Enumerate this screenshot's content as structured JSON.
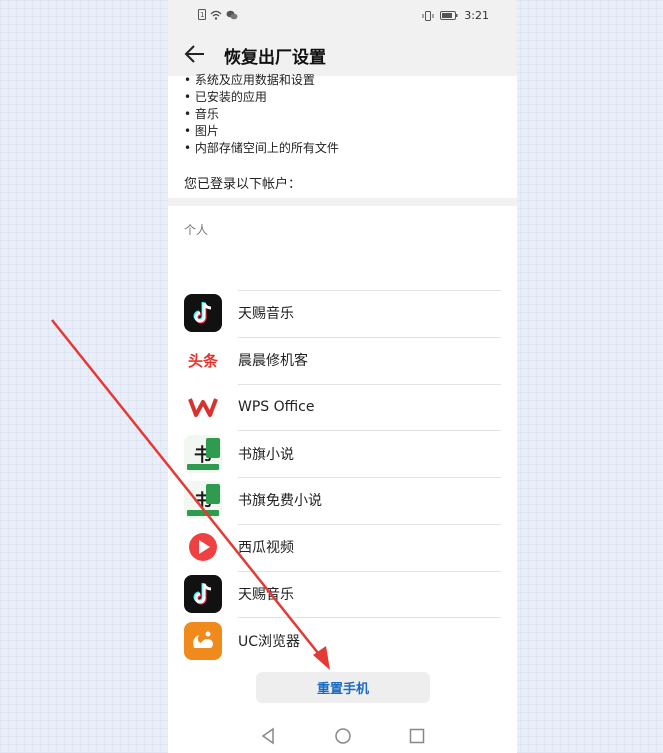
{
  "status_bar": {
    "time": "3:21"
  },
  "header": {
    "title": "恢复出厂设置"
  },
  "erase_list": [
    "系统及应用数据和设置",
    "已安装的应用",
    "音乐",
    "图片",
    "内部存储空间上的所有文件"
  ],
  "accounts": {
    "title": "您已登录以下帐户：",
    "group_label": "个人",
    "items": [
      {
        "name": "天赐音乐",
        "icon": "tiktok-icon",
        "icon_color": "#111111"
      },
      {
        "name": "晨晨修机客",
        "icon": "toutiao-icon",
        "icon_color": "#e8322b",
        "icon_text": "头条"
      },
      {
        "name": "WPS Office",
        "icon": "wps-icon",
        "icon_color": "#d9312b"
      },
      {
        "name": "书旗小说",
        "icon": "shuqi-icon",
        "icon_color": "#2e9b4f",
        "icon_text": "书"
      },
      {
        "name": "书旗免费小说",
        "icon": "shuqi-free-icon",
        "icon_color": "#2e9b4f",
        "icon_text": "书"
      },
      {
        "name": "西瓜视频",
        "icon": "xigua-icon",
        "icon_color": "#f04142"
      },
      {
        "name": "天赐音乐",
        "icon": "tiktok-icon",
        "icon_color": "#111111"
      },
      {
        "name": "UC浏览器",
        "icon": "uc-browser-icon",
        "icon_color": "#f08a1d"
      }
    ]
  },
  "reset_button": {
    "label": "重置手机"
  },
  "colors": {
    "accent": "#1a6bc4",
    "annotation_arrow": "#e53935"
  }
}
